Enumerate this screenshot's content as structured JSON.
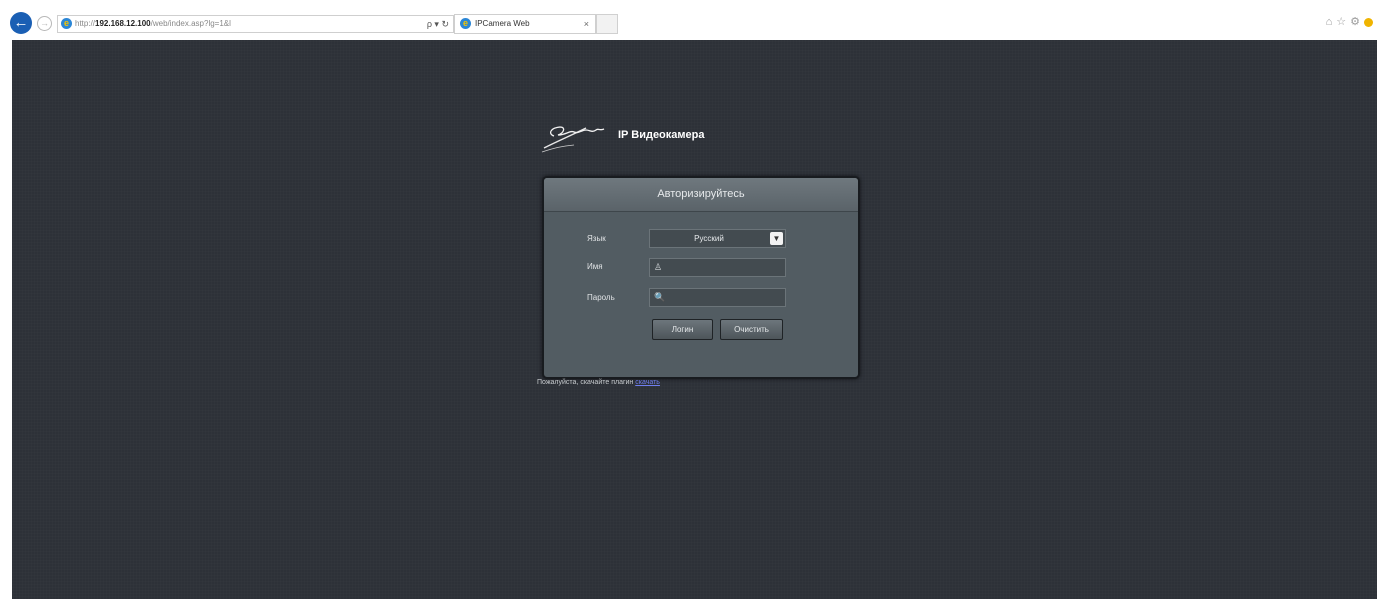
{
  "browser": {
    "address_prefix": "http://",
    "address_host": "192.168.12.100",
    "address_path": "/web/index.asp?lg=1&l",
    "search_controls": "ρ ▾ ↻",
    "tab_title": "IPCamera Web",
    "tab_close": "×",
    "back_icon": "←",
    "forward_icon": "→",
    "ie_icon": "e",
    "tools": [
      "⌂",
      "☆",
      "⚙"
    ]
  },
  "brand": {
    "product": "IP Видеокамера"
  },
  "login": {
    "header": "Авторизируйтесь",
    "language_label": "Язык",
    "language_value": "Русский",
    "select_arrow": "▼",
    "name_label": "Имя",
    "name_icon": "♙",
    "password_label": "Пароль",
    "password_icon": "🔍",
    "login_button": "Логин",
    "clear_button": "Очистить"
  },
  "footer": {
    "plugin_text": "Пожалуйста, скачайте плагин ",
    "plugin_link": "скачать"
  },
  "colors": {
    "page_background": "#2d3138",
    "panel": "#525c62",
    "header": "#6f787e",
    "link": "#6f7ff0"
  }
}
